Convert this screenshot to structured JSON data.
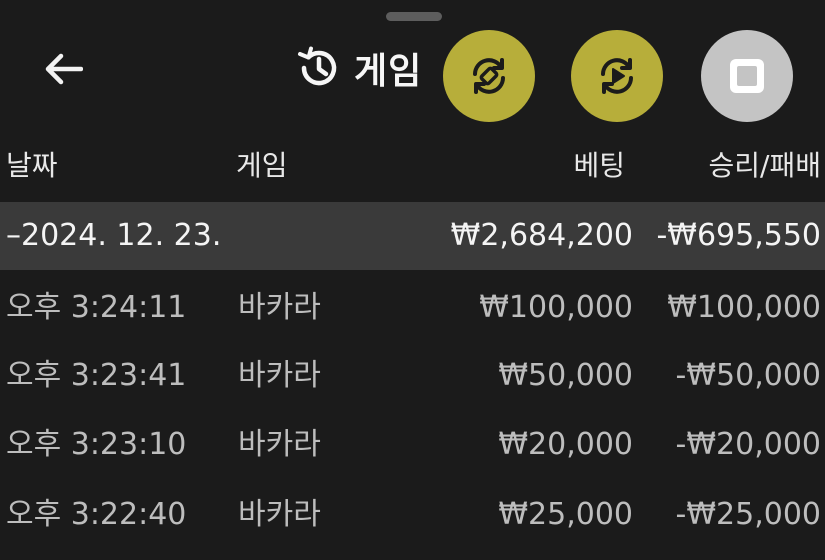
{
  "header": {
    "title": "게임",
    "back_icon": "arrow-left-icon",
    "history_icon": "history-icon"
  },
  "fabs": [
    {
      "name": "auto-swap",
      "icon": "refresh-diamond-icon",
      "color": "#b7ae3a"
    },
    {
      "name": "auto-play",
      "icon": "refresh-play-icon",
      "color": "#b7ae3a"
    },
    {
      "name": "stop",
      "icon": "stop-icon",
      "color": "#c4c4c4"
    }
  ],
  "table": {
    "columns": {
      "date": "날짜",
      "game": "게임",
      "bet": "베팅",
      "result": "승리/패배"
    },
    "group": {
      "date": "–2024. 12. 23.",
      "bet": "₩2,684,200",
      "result": "-₩695,550"
    },
    "rows": [
      {
        "time": "오후 3:24:11",
        "game": "바카라",
        "bet": "₩100,000",
        "result": "₩100,000"
      },
      {
        "time": "오후 3:23:41",
        "game": "바카라",
        "bet": "₩50,000",
        "result": "-₩50,000"
      },
      {
        "time": "오후 3:23:10",
        "game": "바카라",
        "bet": "₩20,000",
        "result": "-₩20,000"
      },
      {
        "time": "오후 3:22:40",
        "game": "바카라",
        "bet": "₩25,000",
        "result": "-₩25,000"
      }
    ]
  },
  "colors": {
    "background": "#1b1b1b",
    "group_row": "#3a3a3a",
    "accent": "#b7ae3a",
    "stop": "#c4c4c4"
  }
}
